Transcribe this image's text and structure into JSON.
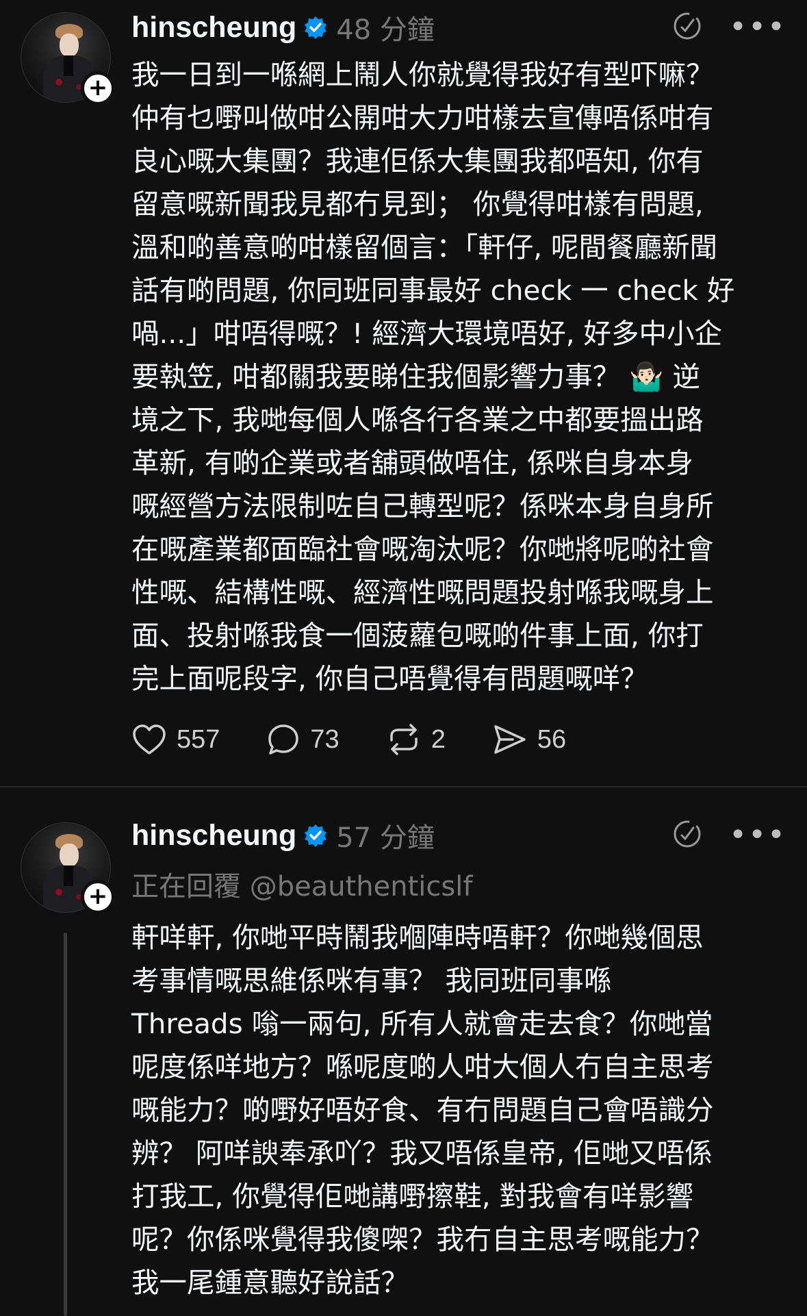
{
  "posts": [
    {
      "username": "hinscheung",
      "timestamp": "48 分鐘",
      "text": "我一日到一喺網上鬧人你就覺得我好有型吓嘛？\n仲有乜嘢叫做咁公開咁大力咁樣去宣傳唔係咁有\n良心嘅大集團？我連佢係大集團我都唔知, 你有\n留意嘅新聞我見都冇見到； 你覺得咁樣有問題,\n溫和啲善意啲咁樣留個言：「軒仔, 呢間餐廳新聞\n話有啲問題, 你同班同事最好 check 一 check 好\n喎...」咁唔得嘅？! 經濟大環境唔好, 好多中小企\n要執笠, 咁都關我要睇住我個影響力事？ 🤷🏻‍♂️ 逆\n境之下, 我哋每個人喺各行各業之中都要搵出路\n革新, 有啲企業或者舖頭做唔住, 係咪自身本身\n嘅經營方法限制咗自己轉型呢？係咪本身自身所\n在嘅產業都面臨社會嘅淘汰呢？你哋將呢啲社會\n性嘅、結構性嘅、經濟性嘅問題投射喺我嘅身上\n面、投射喺我食一個菠蘿包嘅啲件事上面, 你打\n完上面呢段字, 你自己唔覺得有問題嘅咩？",
      "likes": "557",
      "comments": "73",
      "reposts": "2",
      "shares": "56"
    },
    {
      "username": "hinscheung",
      "timestamp": "57 分鐘",
      "reply_prefix": "正在回覆",
      "reply_to": "@beauthenticslf",
      "text": "軒咩軒, 你哋平時鬧我嗰陣時唔軒？你哋幾個思\n考事情嘅思維係咪有事？ 我同班同事喺\nThreads 嗡一兩句, 所有人就會走去食？你哋當\n呢度係咩地方？喺呢度啲人咁大個人冇自主思考\n嘅能力？啲嘢好唔好食、有冇問題自己會唔識分\n辨？ 阿咩諛奉承吖？我又唔係皇帝, 佢哋又唔係\n打我工, 你覺得佢哋講嘢擦鞋, 對我會有咩影響\n呢？你係咪覺得我傻㗎？我冇自主思考嘅能力？\n我一尾鍾意聽好說話？"
    }
  ],
  "icons": {
    "verified": "verified-badge-icon",
    "more": "more-options-icon",
    "follow": "plus-icon",
    "like": "heart-icon",
    "comment": "comment-bubble-icon",
    "repost": "repost-icon",
    "share": "send-icon",
    "thread_status": "dashed-circle-slash-icon"
  },
  "colors": {
    "background": "#101010",
    "verified_blue": "#0095f6",
    "muted": "#777777"
  }
}
